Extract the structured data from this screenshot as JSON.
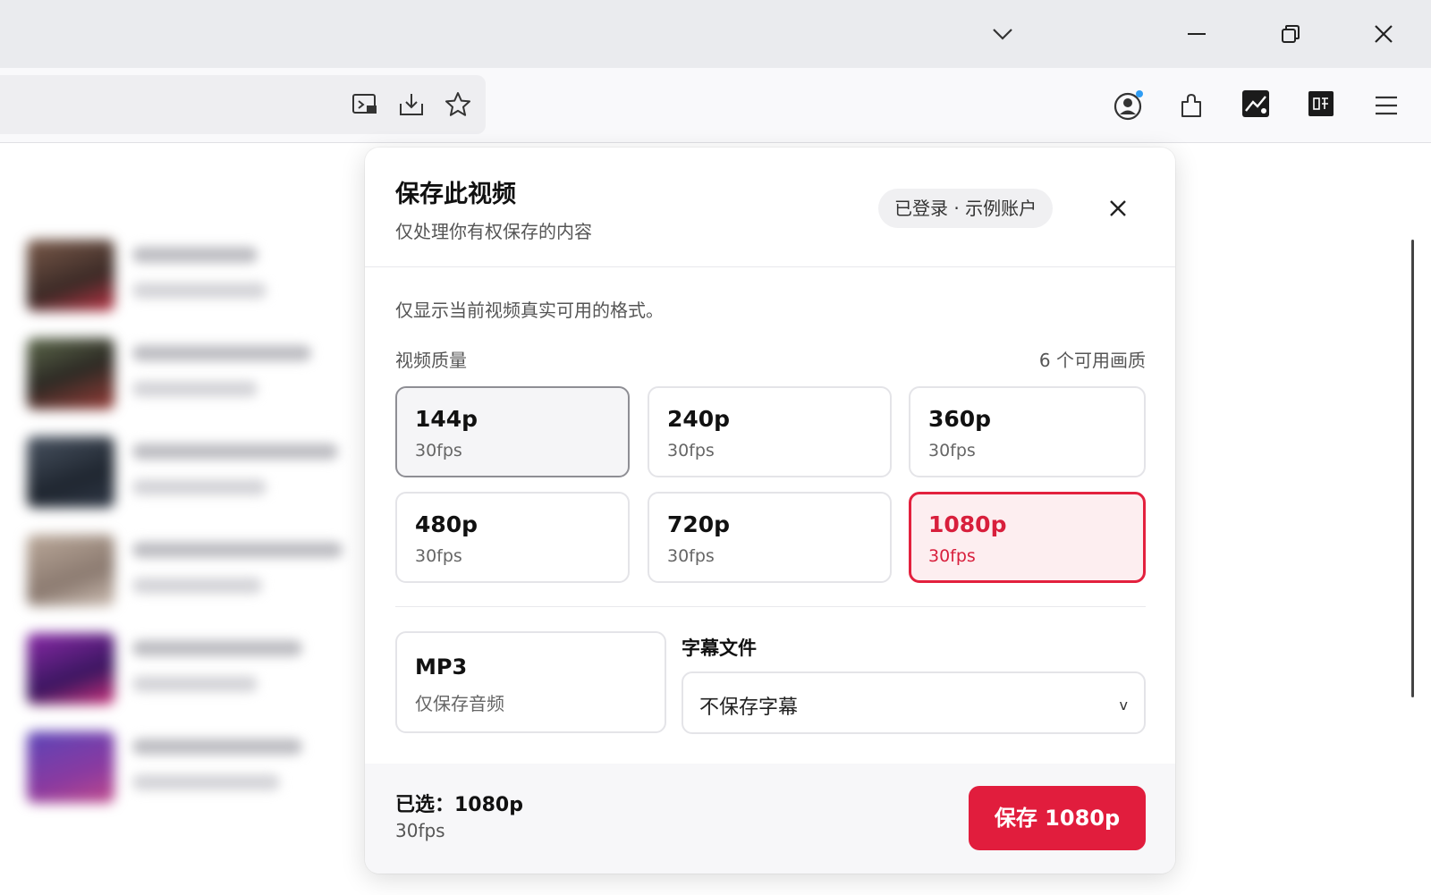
{
  "browser": {
    "window_controls": {
      "tab_list_icon": "chevron-down-icon",
      "minimize_icon": "minimize-icon",
      "restore_icon": "restore-icon",
      "close_icon": "close-icon"
    },
    "toolbar_icons": [
      "screenshot-icon",
      "download-icon",
      "bookmark-star-icon",
      "account-icon",
      "extensions-icon",
      "extension-app-icon",
      "extension-box-icon",
      "menu-icon"
    ]
  },
  "panel": {
    "title": "保存此视频",
    "subtitle": "仅处理你有权保存的内容",
    "account_badge": "已登录 · 示例账户",
    "note": "仅显示当前视频真实可用的格式。",
    "quality_section": {
      "label": "视频质量",
      "count": "6 个可用画质",
      "options": [
        {
          "label": "144p",
          "fps": "30fps"
        },
        {
          "label": "240p",
          "fps": "30fps"
        },
        {
          "label": "360p",
          "fps": "30fps"
        },
        {
          "label": "480p",
          "fps": "30fps"
        },
        {
          "label": "720p",
          "fps": "30fps"
        },
        {
          "label": "1080p",
          "fps": "30fps"
        }
      ]
    },
    "mp3": {
      "title": "MP3",
      "subtitle": "仅保存音频"
    },
    "subtitles": {
      "label": "字幕文件",
      "value": "不保存字幕",
      "chevron": "v"
    },
    "footer": {
      "selected_label": "已选：1080p",
      "selected_fps": "30fps",
      "save_button": "保存 1080p"
    }
  },
  "colors": {
    "accent": "#e11d3d",
    "selected_bg": "#fdeef0"
  }
}
